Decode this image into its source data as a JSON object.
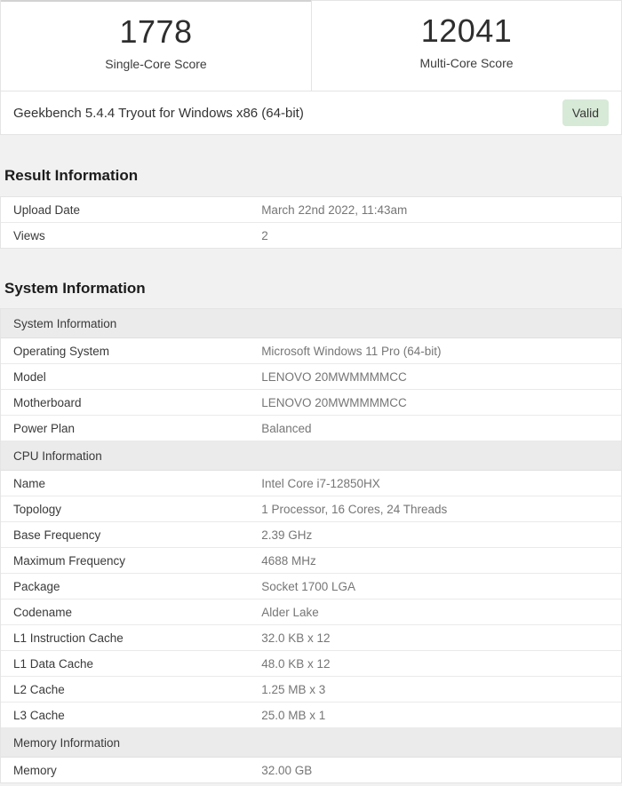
{
  "scores": {
    "single_core": {
      "value": "1778",
      "label": "Single-Core Score"
    },
    "multi_core": {
      "value": "12041",
      "label": "Multi-Core Score"
    }
  },
  "version_bar": {
    "text": "Geekbench 5.4.4 Tryout for Windows x86 (64-bit)",
    "badge_label": "Valid"
  },
  "result_information": {
    "heading": "Result Information",
    "rows": [
      {
        "label": "Upload Date",
        "value": "March 22nd 2022, 11:43am"
      },
      {
        "label": "Views",
        "value": "2"
      }
    ]
  },
  "system_information": {
    "heading": "System Information",
    "groups": [
      {
        "header": "System Information",
        "rows": [
          {
            "label": "Operating System",
            "value": "Microsoft Windows 11 Pro (64-bit)"
          },
          {
            "label": "Model",
            "value": "LENOVO 20MWMMMMCC"
          },
          {
            "label": "Motherboard",
            "value": "LENOVO 20MWMMMMCC"
          },
          {
            "label": "Power Plan",
            "value": "Balanced"
          }
        ]
      },
      {
        "header": "CPU Information",
        "rows": [
          {
            "label": "Name",
            "value": "Intel Core i7-12850HX"
          },
          {
            "label": "Topology",
            "value": "1 Processor, 16 Cores, 24 Threads"
          },
          {
            "label": "Base Frequency",
            "value": "2.39 GHz"
          },
          {
            "label": "Maximum Frequency",
            "value": "4688 MHz"
          },
          {
            "label": "Package",
            "value": "Socket 1700 LGA"
          },
          {
            "label": "Codename",
            "value": "Alder Lake"
          },
          {
            "label": "L1 Instruction Cache",
            "value": "32.0 KB x 12"
          },
          {
            "label": "L1 Data Cache",
            "value": "48.0 KB x 12"
          },
          {
            "label": "L2 Cache",
            "value": "1.25 MB x 3"
          },
          {
            "label": "L3 Cache",
            "value": "25.0 MB x 1"
          }
        ]
      },
      {
        "header": "Memory Information",
        "rows": [
          {
            "label": "Memory",
            "value": "32.00 GB"
          }
        ]
      }
    ]
  },
  "colors": {
    "badge_bg": "#d7e9d7",
    "badge_text": "#373737",
    "page_bg": "#f1f1f2",
    "panel_bg": "#ffffff",
    "border": "#e4e4e4",
    "group_header_bg": "#ebebeb",
    "value_text": "#767676",
    "label_text": "#3a3a3a"
  }
}
